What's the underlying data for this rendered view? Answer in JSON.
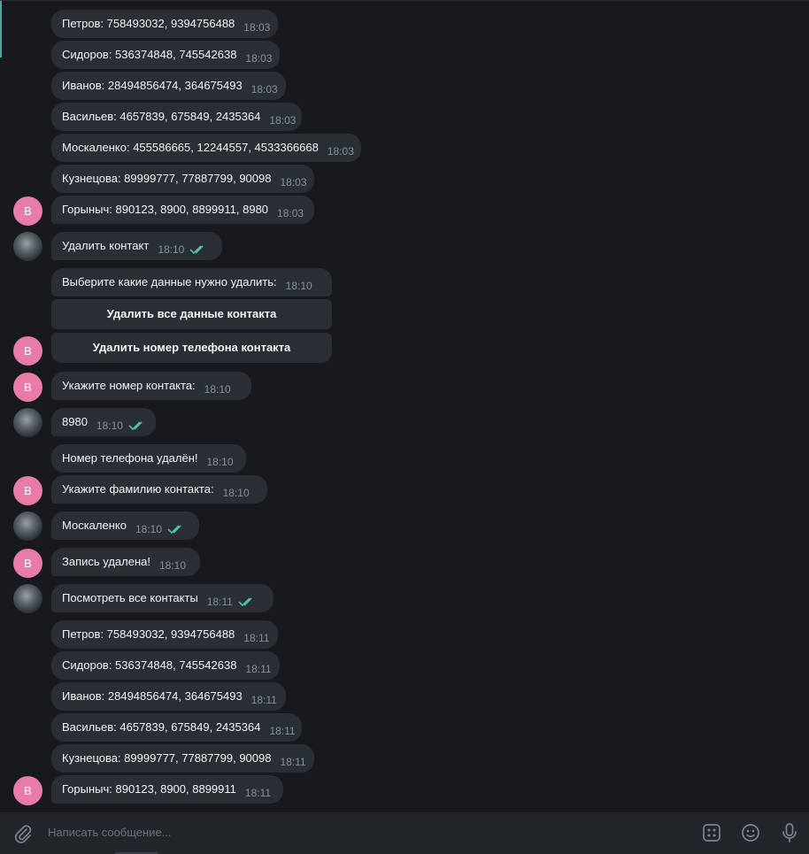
{
  "messages": [
    {
      "text": "Петров: 758493032, 9394756488",
      "time": "18:03"
    },
    {
      "text": "Сидоров: 536374848, 745542638",
      "time": "18:03"
    },
    {
      "text": "Иванов: 28494856474, 364675493",
      "time": "18:03"
    },
    {
      "text": "Васильев: 4657839, 675849, 2435364",
      "time": "18:03"
    },
    {
      "text": "Москаленко: 455586665, 12244557, 4533366668",
      "time": "18:03"
    },
    {
      "text": "Кузнецова: 89999777, 77887799, 90098",
      "time": "18:03"
    },
    {
      "text": "Горыныч: 890123, 8900, 8899911, 8980",
      "time": "18:03"
    },
    {
      "text": "Удалить контакт",
      "time": "18:10"
    },
    {
      "text": "Выберите какие данные нужно удалить:",
      "time": "18:10"
    },
    {
      "text": "Укажите номер контакта:",
      "time": "18:10"
    },
    {
      "text": "8980",
      "time": "18:10"
    },
    {
      "text": "Номер телефона удалён!",
      "time": "18:10"
    },
    {
      "text": "Укажите фамилию контакта:",
      "time": "18:10"
    },
    {
      "text": "Москаленко",
      "time": "18:10"
    },
    {
      "text": "Запись удалена!",
      "time": "18:10"
    },
    {
      "text": "Посмотреть все контакты",
      "time": "18:11"
    },
    {
      "text": "Петров: 758493032, 9394756488",
      "time": "18:11"
    },
    {
      "text": "Сидоров: 536374848, 745542638",
      "time": "18:11"
    },
    {
      "text": "Иванов: 28494856474, 364675493",
      "time": "18:11"
    },
    {
      "text": "Васильев: 4657839, 675849, 2435364",
      "time": "18:11"
    },
    {
      "text": "Кузнецова: 89999777, 77887799, 90098",
      "time": "18:11"
    },
    {
      "text": "Горыныч: 890123, 8900, 8899911",
      "time": "18:11"
    }
  ],
  "keyboard": {
    "delete_all": "Удалить все данные контакта",
    "delete_phone": "Удалить номер телефона контакта"
  },
  "bot_avatar_letter": "B",
  "composer": {
    "placeholder": "Написать сообщение..."
  },
  "colors": {
    "bot_avatar": "#e87ba7",
    "read_checks": "#4fc3a1",
    "bubble": "#2a2f35"
  }
}
